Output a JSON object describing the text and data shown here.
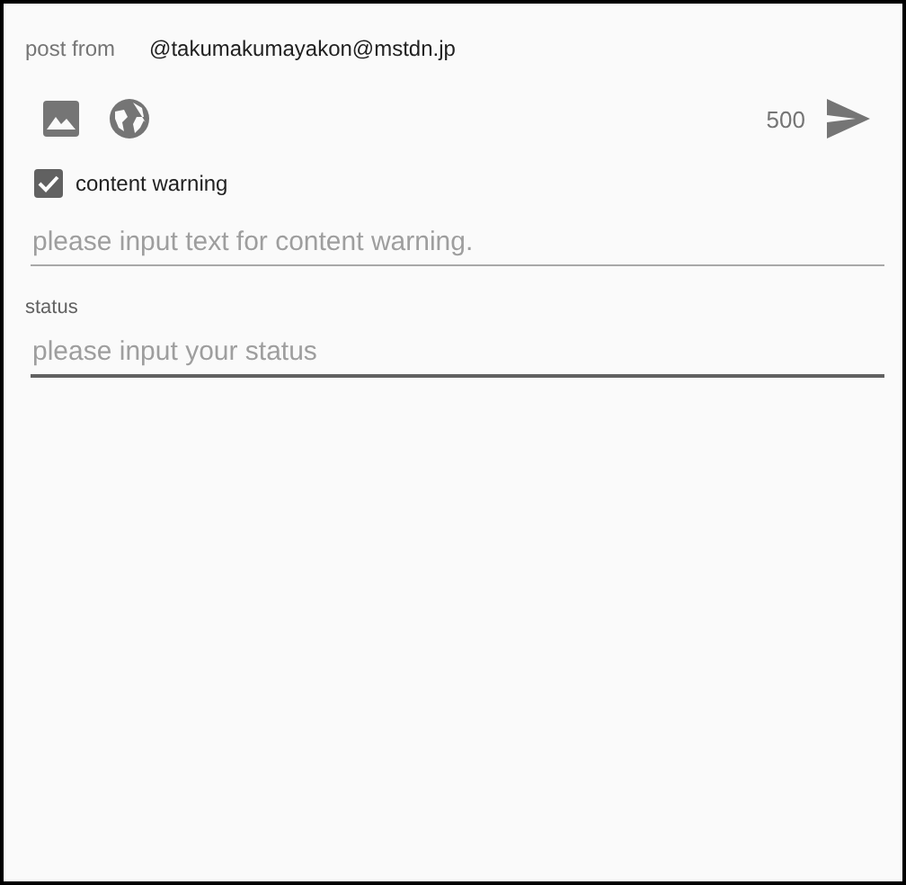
{
  "post_from": {
    "label": "post from",
    "account": "@takumakumayakon@mstdn.jp"
  },
  "toolbar": {
    "char_count": "500"
  },
  "content_warning": {
    "label": "content warning",
    "checked": true
  },
  "cw_field": {
    "placeholder": "please input text for content warning.",
    "focused": false
  },
  "status": {
    "label": "status",
    "placeholder": "please input your status",
    "focused": true
  }
}
